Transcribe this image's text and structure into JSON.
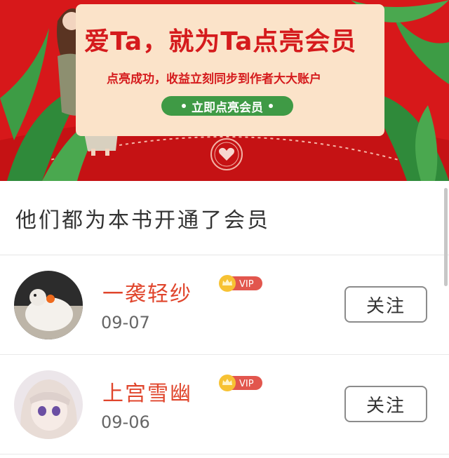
{
  "banner": {
    "title": "爱Ta，就为Ta点亮会员",
    "subtitle": "点亮成功，收益立刻同步到作者大大账户",
    "cta_label": "立即点亮会员",
    "bg_color": "#d7181a",
    "card_color": "#fbe3c9",
    "button_color": "#3f9a45"
  },
  "section": {
    "title": "他们都为本书开通了会员"
  },
  "members": [
    {
      "name": "一袭轻纱",
      "badge": "VIP",
      "date": "09-07",
      "follow_label": "关注"
    },
    {
      "name": "上宫雪幽",
      "badge": "VIP",
      "date": "09-06",
      "follow_label": "关注"
    }
  ],
  "icons": {
    "badge_crown": "crown-icon",
    "seal": "heart-seal-icon"
  }
}
